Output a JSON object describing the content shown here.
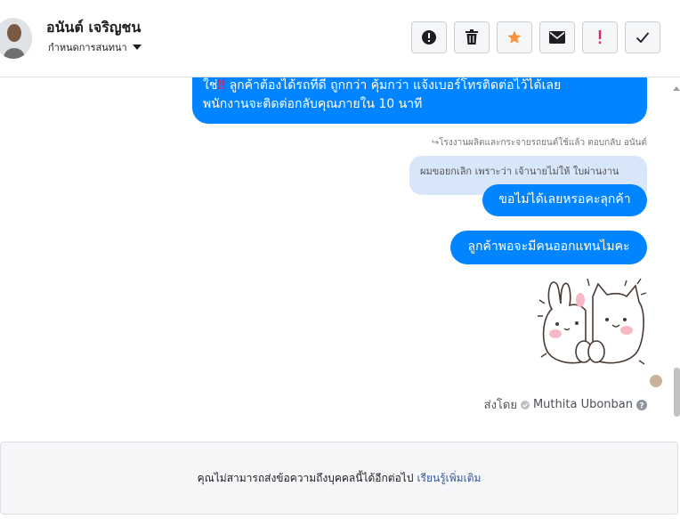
{
  "header": {
    "contact_name": "อนันต์ เจริญชน",
    "subtitle": "กำหนดการสนทนา",
    "buttons": [
      {
        "name": "report-button",
        "icon": "exclamation-circle-icon"
      },
      {
        "name": "delete-button",
        "icon": "trash-icon"
      },
      {
        "name": "star-button",
        "icon": "star-icon",
        "color": "#f7923b"
      },
      {
        "name": "mark-unread-button",
        "icon": "envelope-icon"
      },
      {
        "name": "important-button",
        "icon": "exclamation-icon",
        "color": "#e0245e"
      },
      {
        "name": "mark-done-button",
        "icon": "checkmark-icon"
      }
    ]
  },
  "messages": {
    "first_bubble": {
      "line1_prefix": "ใช่",
      "line1_mark": "‼",
      "line1_rest": " ลูกค้าต้องได้รถที่ดี ถูกกว่า คุ้มกว่า แจ้งเบอร์โทรติดต่อไว้ได้เลย",
      "line2": "พนักงานจะติดต่อกลับคุณภายใน 10 นาที"
    },
    "reply_note": "↪โรงงานผลิตและกระจายรถยนต์ใช้แล้ว ตอบกลับ อนันต์",
    "quoted_text": "ผมขอยกเลิก เพราะว่า เจ้านายไม่ให้ ใบผ่านงาน",
    "bubble2": "ขอไม่ได้เลยหรอคะลุกค้า",
    "bubble3": "ลูกค้าพอจะมีคนออกแทนไมคะ",
    "sticker": "bunny-cat-hug-sticker",
    "sent_by_label": "ส่งโดย",
    "sent_by_name": "Muthita Ubonban"
  },
  "footer": {
    "notice": "คุณไม่สามารถส่งข้อความถึงบุคคลนี้ได้อีกต่อไป",
    "learn_more": "เรียนรู้เพิ่มเติม"
  },
  "colors": {
    "bubble": "#0084ff",
    "quoted": "#d8e6fa",
    "link": "#365899"
  }
}
